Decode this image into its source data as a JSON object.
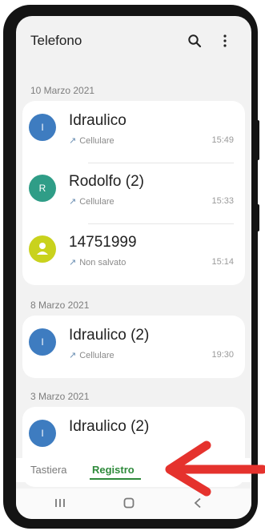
{
  "app": {
    "title": "Telefono"
  },
  "icons": {
    "search": "search-icon",
    "more": "more-vert-icon",
    "call": "outgoing-call-icon",
    "contact": "person-icon",
    "nav_recent": "recent-apps-icon",
    "nav_home": "home-icon",
    "nav_back": "back-icon"
  },
  "groups": [
    {
      "date": "10 Marzo 2021",
      "entries": [
        {
          "initial": "I",
          "color": "#3e7cc0",
          "name": "Idraulico",
          "type": "Cellulare",
          "time": "15:49"
        },
        {
          "initial": "R",
          "color": "#2f9d87",
          "name": "Rodolfo (2)",
          "type": "Cellulare",
          "time": "15:33"
        },
        {
          "initial": "",
          "color": "#c9d21d",
          "name": "14751999",
          "type": "Non salvato",
          "time": "15:14"
        }
      ]
    },
    {
      "date": "8 Marzo 2021",
      "entries": [
        {
          "initial": "I",
          "color": "#3e7cc0",
          "name": "Idraulico (2)",
          "type": "Cellulare",
          "time": "19:30"
        }
      ]
    },
    {
      "date": "3 Marzo 2021",
      "entries": [
        {
          "initial": "I",
          "color": "#3e7cc0",
          "name": "Idraulico (2)",
          "type": "",
          "time": ""
        }
      ]
    }
  ],
  "tabs": {
    "keypad": "Tastiera",
    "log": "Registro"
  },
  "colors": {
    "accent": "#2e8a3b",
    "annotation": "#e5322d"
  }
}
